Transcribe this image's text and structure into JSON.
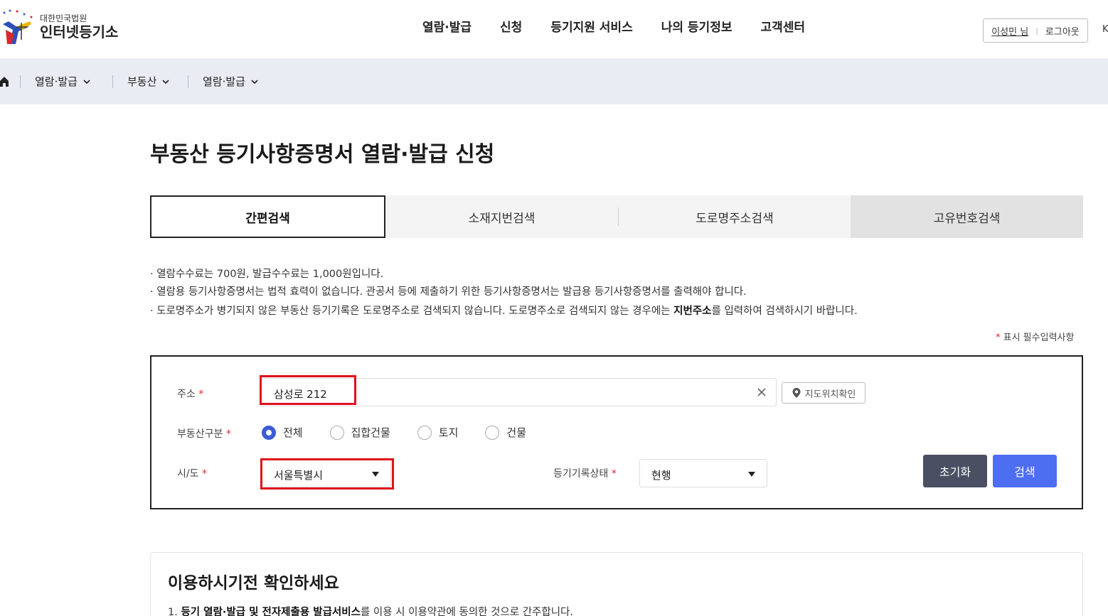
{
  "header": {
    "logo_sub": "대한민국법원",
    "logo_main": "인터넷등기소",
    "nav": [
      "열람·발급",
      "신청",
      "등기지원 서비스",
      "나의 등기정보",
      "고객센터"
    ],
    "user_name": "이성민 님",
    "logout": "로그아웃",
    "lang": "K"
  },
  "breadcrumb": {
    "items": [
      "열람·발급",
      "부동산",
      "열람·발급"
    ]
  },
  "page": {
    "title": "부동산 등기사항증명서 열람·발급 신청"
  },
  "tabs": [
    "간편검색",
    "소재지번검색",
    "도로명주소검색",
    "고유번호검색"
  ],
  "notices": {
    "line1": "· 열람수수료는  700원, 발급수수료는  1,000원입니다.",
    "line2": "· 열람용 등기사항증명서는 법적 효력이 없습니다. 관공서 등에 제출하기 위한 등기사항증명서는 발급용 등기사항증명서를 출력해야 합니다.",
    "line3_a": "· 도로명주소가 병기되지 않은 부동산 등기기록은 도로명주소로 검색되지 않습니다. 도로명주소로 검색되지 않는 경우에는 ",
    "line3_b": "지번주소",
    "line3_c": "를 입력하여 검색하시기 바랍니다."
  },
  "required_note": {
    "star": "*",
    "text": " 표시 필수입력사항"
  },
  "form": {
    "address_label": "주소",
    "address_value": "삼성로 212",
    "map_button": "지도위치확인",
    "property_type_label": "부동산구분",
    "property_types": [
      "전체",
      "집합건물",
      "토지",
      "건물"
    ],
    "property_type_selected": "전체",
    "sido_label": "시/도",
    "sido_value": "서울특별시",
    "record_status_label": "등기기록상태",
    "record_status_value": "현행",
    "reset_button": "초기화",
    "search_button": "검색",
    "required_star": "*"
  },
  "info": {
    "title": "이용하시기전 확인하세요",
    "line1_a": "1. ",
    "line1_b": "등기 열람·발급 및 전자제출용 발급서비스",
    "line1_c": "를 이용 시 이용약관에 동의한 것으로 간주합니다."
  },
  "colors": {
    "accent": "#4e6ef2",
    "reset_button": "#4a5062",
    "highlight": "#e0101e",
    "breadcrumb_bg": "#e9ecf3",
    "radio_checked": "#3b5bd9"
  }
}
